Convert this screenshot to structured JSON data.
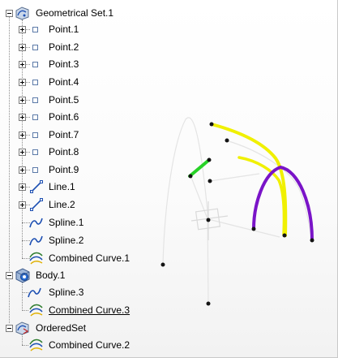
{
  "tree": {
    "geometrical_set": {
      "label": "Geometrical Set.1",
      "children": [
        {
          "label": "Point.1",
          "icon": "point-icon"
        },
        {
          "label": "Point.2",
          "icon": "point-icon"
        },
        {
          "label": "Point.3",
          "icon": "point-icon"
        },
        {
          "label": "Point.4",
          "icon": "point-icon"
        },
        {
          "label": "Point.5",
          "icon": "point-icon"
        },
        {
          "label": "Point.6",
          "icon": "point-icon"
        },
        {
          "label": "Point.7",
          "icon": "point-icon"
        },
        {
          "label": "Point.8",
          "icon": "point-icon"
        },
        {
          "label": "Point.9",
          "icon": "point-icon"
        },
        {
          "label": "Line.1",
          "icon": "line-icon"
        },
        {
          "label": "Line.2",
          "icon": "line-icon"
        },
        {
          "label": "Spline.1",
          "icon": "spline-icon"
        },
        {
          "label": "Spline.2",
          "icon": "spline-icon"
        },
        {
          "label": "Combined Curve.1",
          "icon": "combined-curve-icon"
        }
      ]
    },
    "body": {
      "label": "Body.1",
      "children": [
        {
          "label": "Spline.3",
          "icon": "spline-icon"
        },
        {
          "label": "Combined Curve.3",
          "icon": "combined-curve-icon"
        }
      ]
    },
    "ordered_set": {
      "label": "OrderedSet",
      "children": [
        {
          "label": "Combined Curve.2",
          "icon": "combined-curve-icon"
        }
      ]
    }
  },
  "colors": {
    "yellow_curve": "#f0f000",
    "purple_curve": "#7a14c8",
    "green_line": "#28d228",
    "construction": "#e6e6e6",
    "point": "#141414"
  }
}
